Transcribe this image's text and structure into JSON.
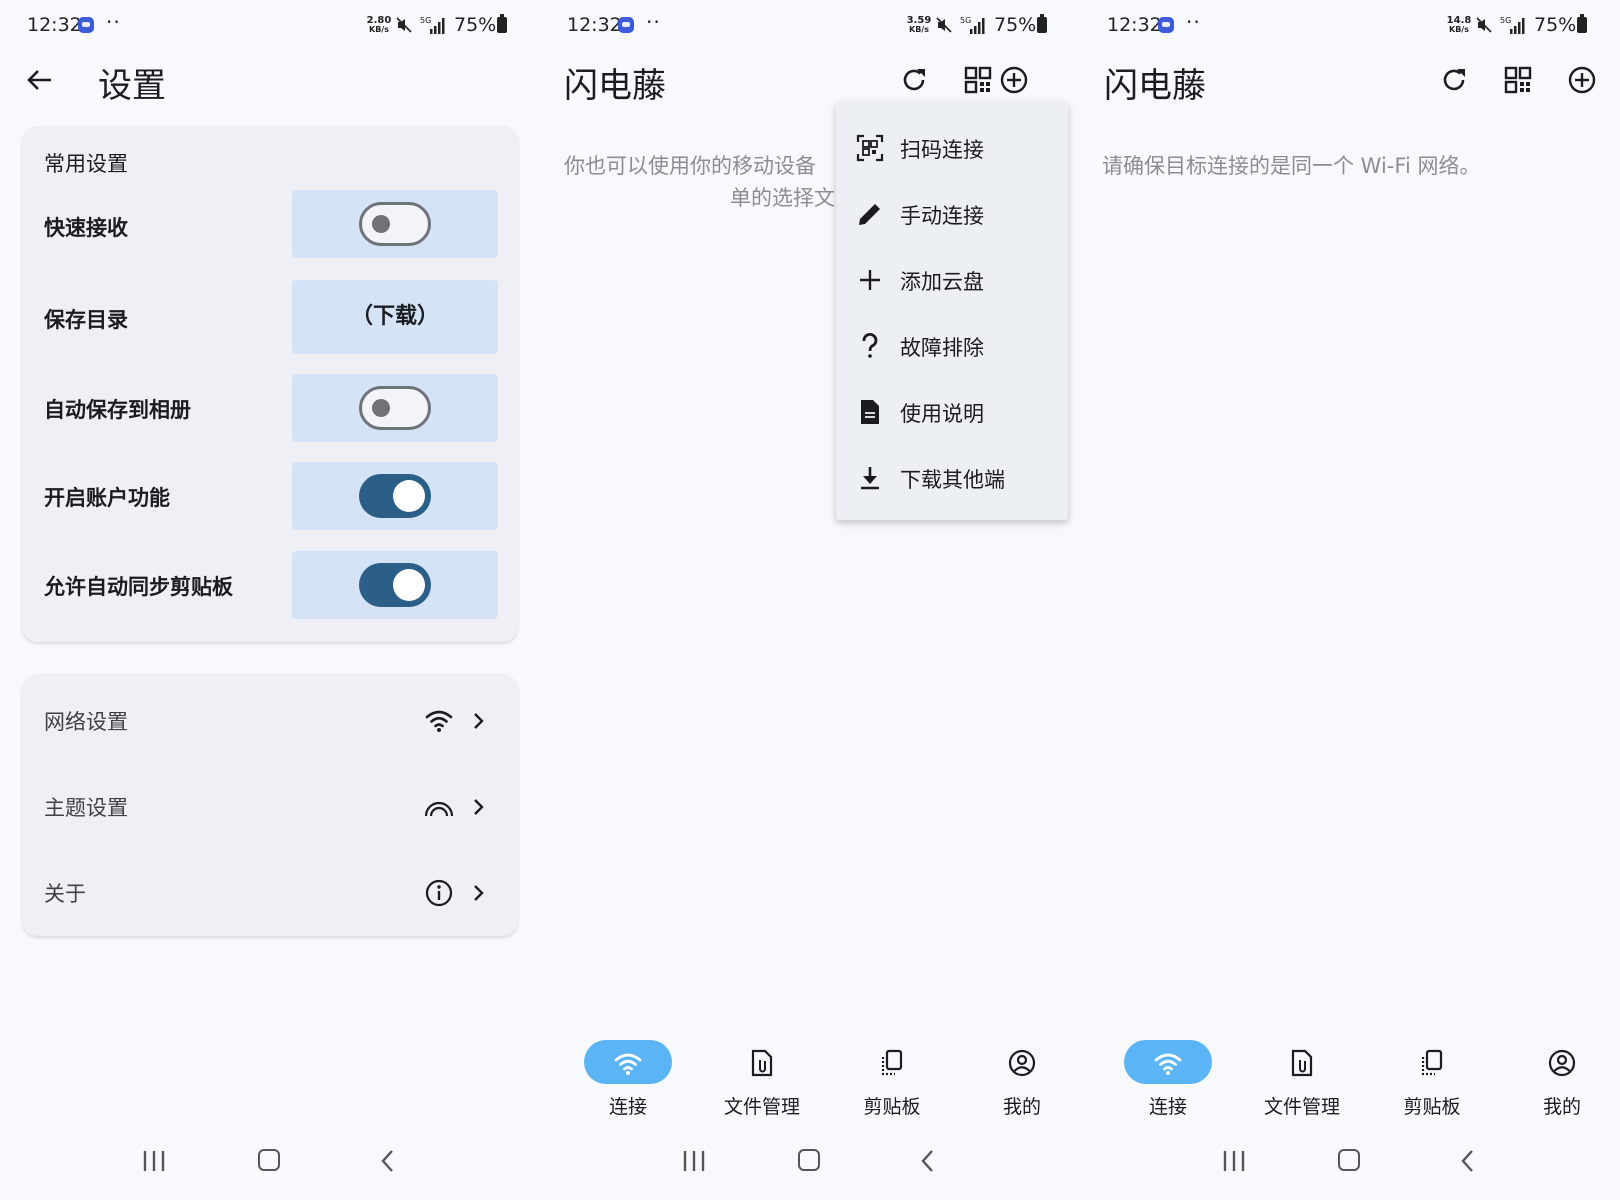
{
  "screens": [
    {
      "status": {
        "time": "12:32",
        "dots": "··",
        "speed_value": "2.80",
        "speed_unit": "KB/s",
        "network": "5G",
        "battery": "75%"
      },
      "title": "设置",
      "common_card": {
        "title": "常用设置",
        "quick_receive": {
          "label": "快速接收",
          "on": false
        },
        "save_dir": {
          "label": "保存目录",
          "value": "（下载）"
        },
        "auto_save_album": {
          "label": "自动保存到相册",
          "on": false
        },
        "account": {
          "label": "开启账户功能",
          "on": true
        },
        "sync_clipboard": {
          "label": "允许自动同步剪贴板",
          "on": true
        }
      },
      "nav_card": {
        "network": {
          "label": "网络设置",
          "icon": "wifi-icon"
        },
        "theme": {
          "label": "主题设置",
          "icon": "rainbow-icon"
        },
        "about": {
          "label": "关于",
          "icon": "info-icon"
        }
      }
    },
    {
      "status": {
        "time": "12:32",
        "dots": "··",
        "speed_value": "3.59",
        "speed_unit": "KB/s",
        "network": "5G",
        "battery": "75%"
      },
      "title": "闪电藤",
      "hint_line1": "你也可以使用你的移动设备",
      "hint_line2": "单的选择文",
      "menu": [
        {
          "label": "扫码连接",
          "icon": "qr-scan-icon"
        },
        {
          "label": "手动连接",
          "icon": "pencil-icon"
        },
        {
          "label": "添加云盘",
          "icon": "plus-icon"
        },
        {
          "label": "故障排除",
          "icon": "question-icon"
        },
        {
          "label": "使用说明",
          "icon": "document-icon"
        },
        {
          "label": "下载其他端",
          "icon": "download-icon"
        }
      ],
      "bottom_nav": [
        {
          "label": "连接",
          "icon": "wifi-icon",
          "active": true
        },
        {
          "label": "文件管理",
          "icon": "file-icon",
          "active": false
        },
        {
          "label": "剪贴板",
          "icon": "clipboard-icon",
          "active": false
        },
        {
          "label": "我的",
          "icon": "account-icon",
          "active": false
        }
      ]
    },
    {
      "status": {
        "time": "12:32",
        "dots": "··",
        "speed_value": "14.8",
        "speed_unit": "KB/s",
        "network": "5G",
        "battery": "75%"
      },
      "title": "闪电藤",
      "hint": "请确保目标连接的是同一个 Wi-Fi 网络。",
      "bottom_nav": [
        {
          "label": "连接",
          "icon": "wifi-icon",
          "active": true
        },
        {
          "label": "文件管理",
          "icon": "file-icon",
          "active": false
        },
        {
          "label": "剪贴板",
          "icon": "clipboard-icon",
          "active": false
        },
        {
          "label": "我的",
          "icon": "account-icon",
          "active": false
        }
      ]
    }
  ],
  "colors": {
    "background": "#f8f9fc",
    "card": "#eef0f5",
    "row_box": "#d5e3f7",
    "switch_on": "#2b5f88",
    "active_pill": "#5ab4f5",
    "menu": "#eceff4"
  }
}
